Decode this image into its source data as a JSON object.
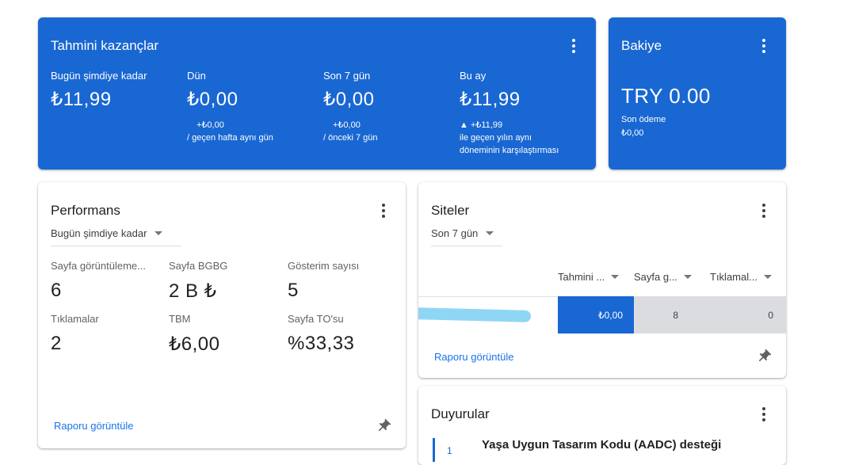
{
  "earnings": {
    "title": "Tahmini kazançlar",
    "columns": [
      {
        "label": "Bugün şimdiye kadar",
        "value": "₺11,99",
        "sub1": "",
        "sub2": "",
        "sub3": ""
      },
      {
        "label": "Dün",
        "value": "₺0,00",
        "sub1": "+₺0,00",
        "sub2": "/ geçen hafta aynı gün",
        "sub3": ""
      },
      {
        "label": "Son 7 gün",
        "value": "₺0,00",
        "sub1": "+₺0,00",
        "sub2": "/ önceki 7 gün",
        "sub3": ""
      },
      {
        "label": "Bu ay",
        "value": "₺11,99",
        "sub1": "▲ +₺11,99",
        "sub2": "ile geçen yılın aynı",
        "sub3": "döneminin karşılaştırması"
      }
    ]
  },
  "balance": {
    "title": "Bakiye",
    "value": "TRY 0.00",
    "last_payment_label": "Son ödeme",
    "last_payment_value": "₺0,00"
  },
  "performance": {
    "title": "Performans",
    "range": "Bugün şimdiye kadar",
    "metrics": [
      {
        "label": "Sayfa görüntüleme...",
        "value": "6"
      },
      {
        "label": "Sayfa BGBG",
        "value": "2 B ₺"
      },
      {
        "label": "Gösterim sayısı",
        "value": "5"
      },
      {
        "label": "Tıklamalar",
        "value": "2"
      },
      {
        "label": "TBM",
        "value": "₺6,00"
      },
      {
        "label": "Sayfa TO'su",
        "value": "%33,33"
      }
    ],
    "report_link": "Raporu görüntüle"
  },
  "sites": {
    "title": "Siteler",
    "range": "Son 7 gün",
    "headers": [
      "Tahmini ...",
      "Sayfa g...",
      "Tıklamal..."
    ],
    "row": {
      "earnings": "₺0,00",
      "pageviews": "8",
      "clicks": "0"
    },
    "report_link": "Raporu görüntüle"
  },
  "announcements": {
    "title": "Duyurular",
    "items": [
      {
        "num": "1",
        "text": "Yaşa Uygun Tasarım Kodu (AADC) desteği"
      }
    ]
  },
  "colors": {
    "primary_blue": "#1967d2",
    "link_blue": "#1a73e8",
    "redaction": "#8fd6f5"
  },
  "icons": {
    "menu": "more-vert-icon",
    "pin": "push-pin-icon",
    "dropdown": "arrow-drop-down-icon"
  }
}
